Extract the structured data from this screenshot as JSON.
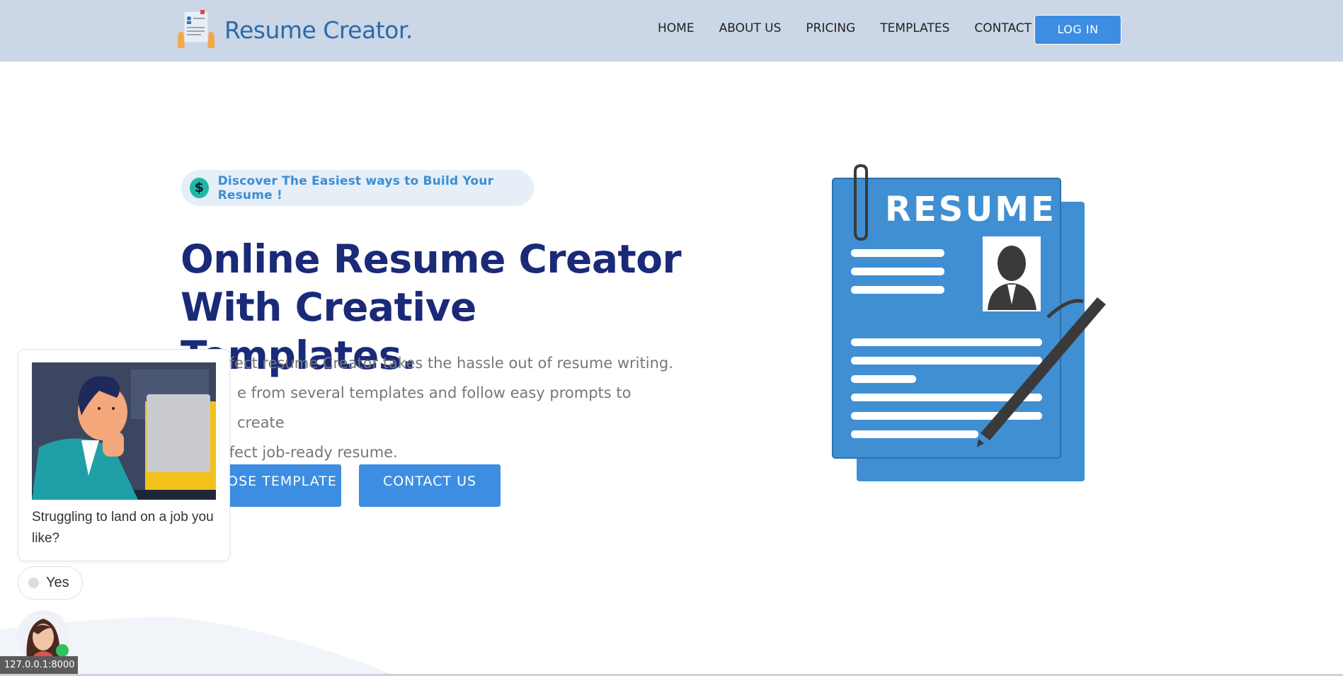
{
  "header": {
    "brand": "Resume Creator.",
    "nav": [
      {
        "label": "HOME"
      },
      {
        "label": "ABOUT US"
      },
      {
        "label": "PRICING"
      },
      {
        "label": "TEMPLATES"
      },
      {
        "label": "CONTACT"
      }
    ],
    "login_label": "LOG IN"
  },
  "hero": {
    "pill_icon": "$",
    "pill_text": "Discover The Easiest ways to Build Your Resume !",
    "headline_line1": "Online Resume Creator",
    "headline_line2": "With Creative Templates.",
    "desc_line1": "rfect resume Creator takes the hassle out of resume writing.",
    "desc_line2": "e from several templates and follow easy prompts to create",
    "desc_line3": "rfect job-ready resume.",
    "choose_label": "OSE TEMPLATE",
    "contact_label": "CONTACT US"
  },
  "illustration": {
    "resume_label": "RESUME"
  },
  "chat": {
    "question": "Struggling to land on a job you like?",
    "yes_label": "Yes"
  },
  "status": {
    "url": "127.0.0.1:8000"
  },
  "colors": {
    "header_bg": "#cbd6e6",
    "accent": "#3d8ee3",
    "headline": "#1a2a78",
    "resume_blue": "#3f8fd2"
  }
}
